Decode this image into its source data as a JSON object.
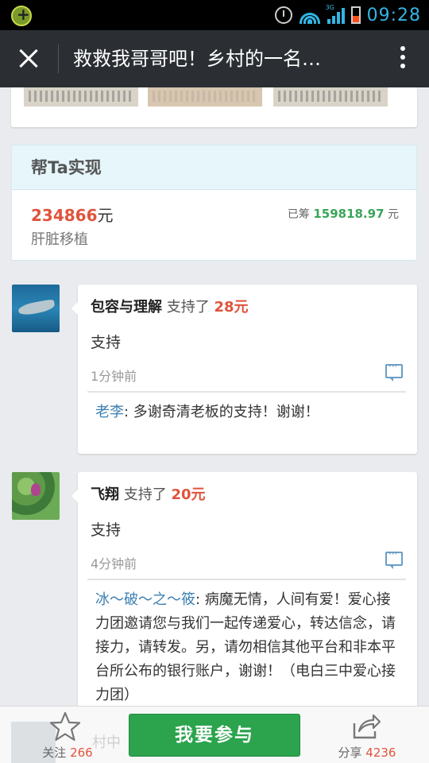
{
  "status_bar": {
    "time": "09:28",
    "network": "3G",
    "icons": [
      "app-icon",
      "alarm-icon",
      "wifi-icon",
      "signal-icon",
      "battery-icon"
    ],
    "accent_color": "#33b5e5"
  },
  "title_bar": {
    "title": "救救我哥哥吧！乡村的一名…",
    "icons": [
      "close-icon",
      "more-vertical-icon"
    ]
  },
  "project": {
    "header": "帮Ta实现",
    "target_amount": "234866",
    "target_unit": "元",
    "raised_label": "已筹",
    "raised_amount": "159818.97",
    "raised_unit": "元",
    "description": "肝脏移植"
  },
  "comments": [
    {
      "name": "包容与理解",
      "action": "支持了",
      "amount": "28元",
      "message": "支持",
      "time": "1分钟前",
      "avatar": "shark-avatar",
      "reply": {
        "name": "老李",
        "separator": ": ",
        "text": "多谢奇清老板的支持！谢谢！"
      }
    },
    {
      "name": "飞翔",
      "action": "支持了",
      "amount": "20元",
      "message": "支持",
      "time": "4分钟前",
      "avatar": "lotus-avatar",
      "reply": {
        "name": "冰～破～之～筱",
        "separator": ": ",
        "text": "病魔无情，人间有爱！爱心接力团邀请您与我们一起传递爱心，转达信念，请接力，请转发。另，请勿相信其他平台和非本平台所公布的银行账户，谢谢！（电白三中爱心接力团）"
      }
    }
  ],
  "bottom_bar": {
    "follow_label": "关注",
    "follow_count": "266",
    "join_label": "我要参与",
    "share_label": "分享",
    "share_count": "4236",
    "partial_row_text": "村中",
    "join_color": "#2ca34d"
  },
  "colors": {
    "amount_red": "#e0533c",
    "raised_green": "#3aa55a",
    "reply_name_blue": "#3c7fb1",
    "titlebar_bg": "#2b2f33"
  }
}
